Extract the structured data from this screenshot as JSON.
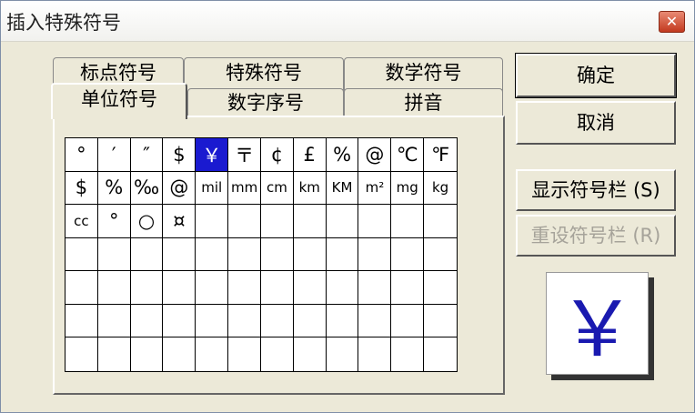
{
  "window": {
    "title": "插入特殊符号"
  },
  "tabs_back": [
    "标点符号",
    "特殊符号",
    "数学符号"
  ],
  "tabs_front": [
    "单位符号",
    "数字序号",
    "拼音"
  ],
  "grid": {
    "cells": [
      "°",
      "′",
      "″",
      "$",
      "￥",
      "〒",
      "¢",
      "£",
      "%",
      "@",
      "℃",
      "℉",
      "$",
      "%",
      "‰",
      "@",
      "mil",
      "mm",
      "cm",
      "km",
      "KM",
      "m²",
      "mg",
      "kg",
      "cc",
      "°",
      "○",
      "¤",
      "",
      "",
      "",
      "",
      "",
      "",
      "",
      "",
      "",
      "",
      "",
      "",
      "",
      "",
      "",
      "",
      "",
      "",
      "",
      "",
      "",
      "",
      "",
      "",
      "",
      "",
      "",
      "",
      "",
      "",
      "",
      "",
      "",
      "",
      "",
      "",
      "",
      "",
      "",
      "",
      "",
      "",
      "",
      "",
      "",
      "",
      "",
      "",
      "",
      "",
      "",
      "",
      "",
      "",
      "",
      ""
    ],
    "selected_index": 4
  },
  "buttons": {
    "ok": "确定",
    "cancel": "取消",
    "show_bar": "显示符号栏 (S)",
    "reset_bar": "重设符号栏 (R)"
  },
  "preview": {
    "symbol": "￥"
  },
  "icons": {
    "close": "close-icon"
  },
  "colors": {
    "selection": "#1a1ad0",
    "preview_text": "#1a1ab0",
    "close_button": "#c2391f"
  }
}
